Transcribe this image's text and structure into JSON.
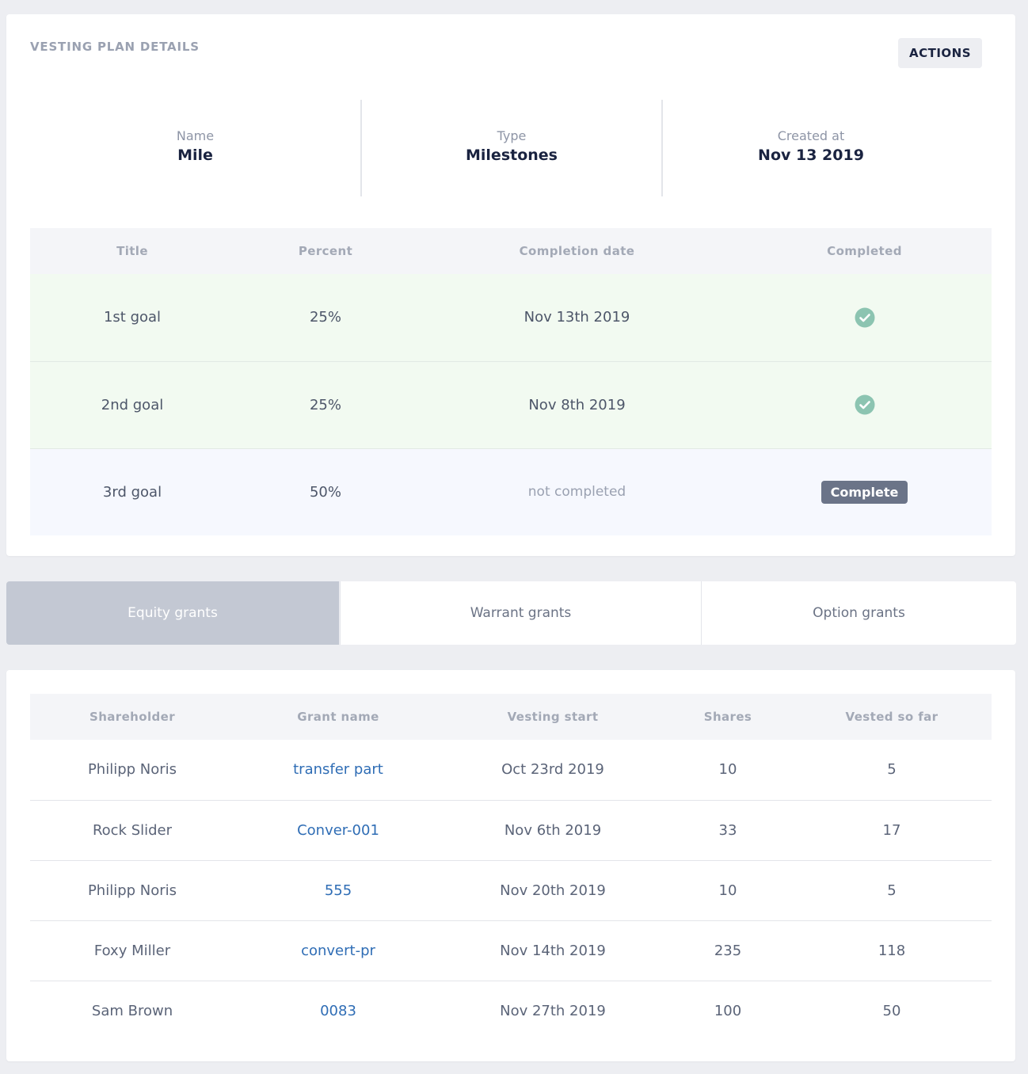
{
  "details": {
    "title": "VESTING PLAN DETAILS",
    "actions_label": "ACTIONS",
    "name_label": "Name",
    "name_value": "Mile",
    "type_label": "Type",
    "type_value": "Milestones",
    "created_label": "Created at",
    "created_value": "Nov 13 2019"
  },
  "milestones": {
    "headers": [
      "Title",
      "Percent",
      "Completion date",
      "Completed"
    ],
    "rows": [
      {
        "title": "1st goal",
        "percent": "25%",
        "date": "Nov 13th 2019",
        "completed": true
      },
      {
        "title": "2nd goal",
        "percent": "25%",
        "date": "Nov 8th 2019",
        "completed": true
      },
      {
        "title": "3rd goal",
        "percent": "50%",
        "date": "not completed",
        "completed": false,
        "action_label": "Complete"
      }
    ]
  },
  "tabs": [
    {
      "label": "Equity grants",
      "active": true
    },
    {
      "label": "Warrant grants",
      "active": false
    },
    {
      "label": "Option grants",
      "active": false
    }
  ],
  "grants": {
    "headers": [
      "Shareholder",
      "Grant name",
      "Vesting start",
      "Shares",
      "Vested so far"
    ],
    "rows": [
      {
        "shareholder": "Philipp Noris",
        "grant": "transfer part",
        "start": "Oct 23rd 2019",
        "shares": "10",
        "vested": "5"
      },
      {
        "shareholder": "Rock Slider",
        "grant": "Conver-001",
        "start": "Nov 6th 2019",
        "shares": "33",
        "vested": "17"
      },
      {
        "shareholder": "Philipp Noris",
        "grant": "555",
        "start": "Nov 20th 2019",
        "shares": "10",
        "vested": "5"
      },
      {
        "shareholder": "Foxy Miller",
        "grant": "convert-pr",
        "start": "Nov 14th 2019",
        "shares": "235",
        "vested": "118"
      },
      {
        "shareholder": "Sam Brown",
        "grant": "0083",
        "start": "Nov 27th 2019",
        "shares": "100",
        "vested": "50"
      }
    ]
  },
  "colors": {
    "check": "#8cc4b1",
    "link": "#2f6db5",
    "active_tab": "#c3c8d3",
    "complete_button": "#6b7488"
  }
}
